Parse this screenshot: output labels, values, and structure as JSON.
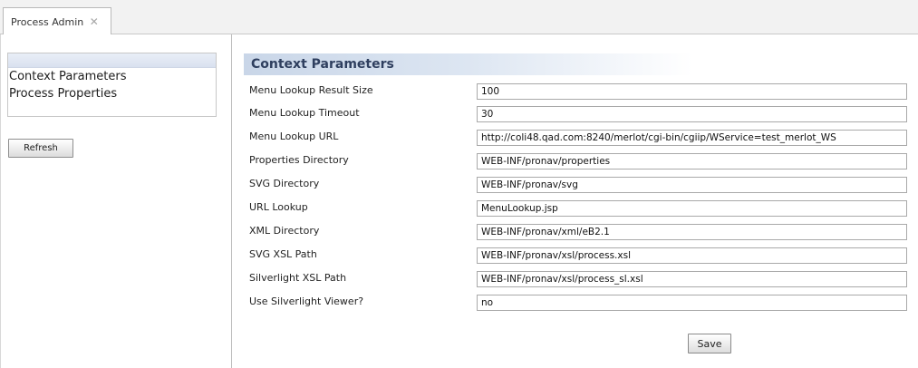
{
  "tab": {
    "label": "Process Admin",
    "close": "✕"
  },
  "sidebar": {
    "items": [
      {
        "label": "Context Parameters"
      },
      {
        "label": "Process Properties"
      }
    ],
    "refresh_label": "Refresh"
  },
  "main": {
    "title": "Context Parameters",
    "fields": [
      {
        "label": "Menu Lookup Result Size",
        "value": "100"
      },
      {
        "label": "Menu Lookup Timeout",
        "value": "30"
      },
      {
        "label": "Menu Lookup URL",
        "value": "http://coli48.qad.com:8240/merlot/cgi-bin/cgiip/WService=test_merlot_WS"
      },
      {
        "label": "Properties Directory",
        "value": "WEB-INF/pronav/properties"
      },
      {
        "label": "SVG Directory",
        "value": "WEB-INF/pronav/svg"
      },
      {
        "label": "URL Lookup",
        "value": "MenuLookup.jsp"
      },
      {
        "label": "XML Directory",
        "value": "WEB-INF/pronav/xml/eB2.1"
      },
      {
        "label": "SVG XSL Path",
        "value": "WEB-INF/pronav/xsl/process.xsl"
      },
      {
        "label": "Silverlight XSL Path",
        "value": "WEB-INF/pronav/xsl/process_sl.xsl"
      },
      {
        "label": "Use Silverlight Viewer?",
        "value": "no"
      }
    ],
    "save_label": "Save"
  }
}
